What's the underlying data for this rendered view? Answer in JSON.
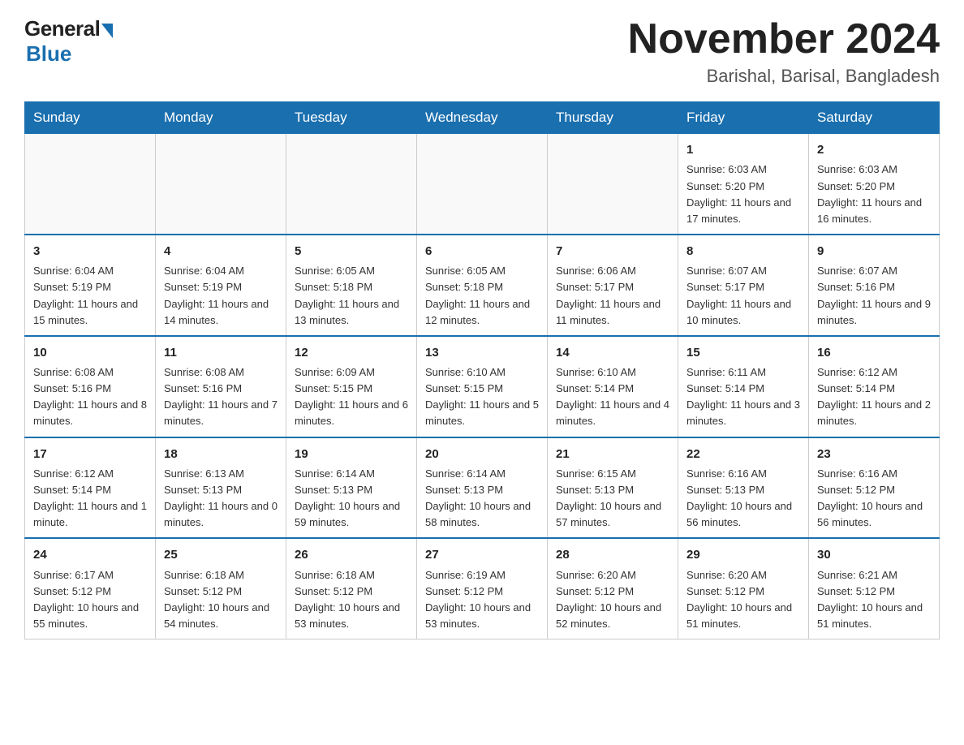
{
  "header": {
    "logo_general": "General",
    "logo_blue": "Blue",
    "month_title": "November 2024",
    "location": "Barishal, Barisal, Bangladesh"
  },
  "weekdays": [
    "Sunday",
    "Monday",
    "Tuesday",
    "Wednesday",
    "Thursday",
    "Friday",
    "Saturday"
  ],
  "weeks": [
    [
      {
        "day": "",
        "sunrise": "",
        "sunset": "",
        "daylight": ""
      },
      {
        "day": "",
        "sunrise": "",
        "sunset": "",
        "daylight": ""
      },
      {
        "day": "",
        "sunrise": "",
        "sunset": "",
        "daylight": ""
      },
      {
        "day": "",
        "sunrise": "",
        "sunset": "",
        "daylight": ""
      },
      {
        "day": "",
        "sunrise": "",
        "sunset": "",
        "daylight": ""
      },
      {
        "day": "1",
        "sunrise": "Sunrise: 6:03 AM",
        "sunset": "Sunset: 5:20 PM",
        "daylight": "Daylight: 11 hours and 17 minutes."
      },
      {
        "day": "2",
        "sunrise": "Sunrise: 6:03 AM",
        "sunset": "Sunset: 5:20 PM",
        "daylight": "Daylight: 11 hours and 16 minutes."
      }
    ],
    [
      {
        "day": "3",
        "sunrise": "Sunrise: 6:04 AM",
        "sunset": "Sunset: 5:19 PM",
        "daylight": "Daylight: 11 hours and 15 minutes."
      },
      {
        "day": "4",
        "sunrise": "Sunrise: 6:04 AM",
        "sunset": "Sunset: 5:19 PM",
        "daylight": "Daylight: 11 hours and 14 minutes."
      },
      {
        "day": "5",
        "sunrise": "Sunrise: 6:05 AM",
        "sunset": "Sunset: 5:18 PM",
        "daylight": "Daylight: 11 hours and 13 minutes."
      },
      {
        "day": "6",
        "sunrise": "Sunrise: 6:05 AM",
        "sunset": "Sunset: 5:18 PM",
        "daylight": "Daylight: 11 hours and 12 minutes."
      },
      {
        "day": "7",
        "sunrise": "Sunrise: 6:06 AM",
        "sunset": "Sunset: 5:17 PM",
        "daylight": "Daylight: 11 hours and 11 minutes."
      },
      {
        "day": "8",
        "sunrise": "Sunrise: 6:07 AM",
        "sunset": "Sunset: 5:17 PM",
        "daylight": "Daylight: 11 hours and 10 minutes."
      },
      {
        "day": "9",
        "sunrise": "Sunrise: 6:07 AM",
        "sunset": "Sunset: 5:16 PM",
        "daylight": "Daylight: 11 hours and 9 minutes."
      }
    ],
    [
      {
        "day": "10",
        "sunrise": "Sunrise: 6:08 AM",
        "sunset": "Sunset: 5:16 PM",
        "daylight": "Daylight: 11 hours and 8 minutes."
      },
      {
        "day": "11",
        "sunrise": "Sunrise: 6:08 AM",
        "sunset": "Sunset: 5:16 PM",
        "daylight": "Daylight: 11 hours and 7 minutes."
      },
      {
        "day": "12",
        "sunrise": "Sunrise: 6:09 AM",
        "sunset": "Sunset: 5:15 PM",
        "daylight": "Daylight: 11 hours and 6 minutes."
      },
      {
        "day": "13",
        "sunrise": "Sunrise: 6:10 AM",
        "sunset": "Sunset: 5:15 PM",
        "daylight": "Daylight: 11 hours and 5 minutes."
      },
      {
        "day": "14",
        "sunrise": "Sunrise: 6:10 AM",
        "sunset": "Sunset: 5:14 PM",
        "daylight": "Daylight: 11 hours and 4 minutes."
      },
      {
        "day": "15",
        "sunrise": "Sunrise: 6:11 AM",
        "sunset": "Sunset: 5:14 PM",
        "daylight": "Daylight: 11 hours and 3 minutes."
      },
      {
        "day": "16",
        "sunrise": "Sunrise: 6:12 AM",
        "sunset": "Sunset: 5:14 PM",
        "daylight": "Daylight: 11 hours and 2 minutes."
      }
    ],
    [
      {
        "day": "17",
        "sunrise": "Sunrise: 6:12 AM",
        "sunset": "Sunset: 5:14 PM",
        "daylight": "Daylight: 11 hours and 1 minute."
      },
      {
        "day": "18",
        "sunrise": "Sunrise: 6:13 AM",
        "sunset": "Sunset: 5:13 PM",
        "daylight": "Daylight: 11 hours and 0 minutes."
      },
      {
        "day": "19",
        "sunrise": "Sunrise: 6:14 AM",
        "sunset": "Sunset: 5:13 PM",
        "daylight": "Daylight: 10 hours and 59 minutes."
      },
      {
        "day": "20",
        "sunrise": "Sunrise: 6:14 AM",
        "sunset": "Sunset: 5:13 PM",
        "daylight": "Daylight: 10 hours and 58 minutes."
      },
      {
        "day": "21",
        "sunrise": "Sunrise: 6:15 AM",
        "sunset": "Sunset: 5:13 PM",
        "daylight": "Daylight: 10 hours and 57 minutes."
      },
      {
        "day": "22",
        "sunrise": "Sunrise: 6:16 AM",
        "sunset": "Sunset: 5:13 PM",
        "daylight": "Daylight: 10 hours and 56 minutes."
      },
      {
        "day": "23",
        "sunrise": "Sunrise: 6:16 AM",
        "sunset": "Sunset: 5:12 PM",
        "daylight": "Daylight: 10 hours and 56 minutes."
      }
    ],
    [
      {
        "day": "24",
        "sunrise": "Sunrise: 6:17 AM",
        "sunset": "Sunset: 5:12 PM",
        "daylight": "Daylight: 10 hours and 55 minutes."
      },
      {
        "day": "25",
        "sunrise": "Sunrise: 6:18 AM",
        "sunset": "Sunset: 5:12 PM",
        "daylight": "Daylight: 10 hours and 54 minutes."
      },
      {
        "day": "26",
        "sunrise": "Sunrise: 6:18 AM",
        "sunset": "Sunset: 5:12 PM",
        "daylight": "Daylight: 10 hours and 53 minutes."
      },
      {
        "day": "27",
        "sunrise": "Sunrise: 6:19 AM",
        "sunset": "Sunset: 5:12 PM",
        "daylight": "Daylight: 10 hours and 53 minutes."
      },
      {
        "day": "28",
        "sunrise": "Sunrise: 6:20 AM",
        "sunset": "Sunset: 5:12 PM",
        "daylight": "Daylight: 10 hours and 52 minutes."
      },
      {
        "day": "29",
        "sunrise": "Sunrise: 6:20 AM",
        "sunset": "Sunset: 5:12 PM",
        "daylight": "Daylight: 10 hours and 51 minutes."
      },
      {
        "day": "30",
        "sunrise": "Sunrise: 6:21 AM",
        "sunset": "Sunset: 5:12 PM",
        "daylight": "Daylight: 10 hours and 51 minutes."
      }
    ]
  ]
}
